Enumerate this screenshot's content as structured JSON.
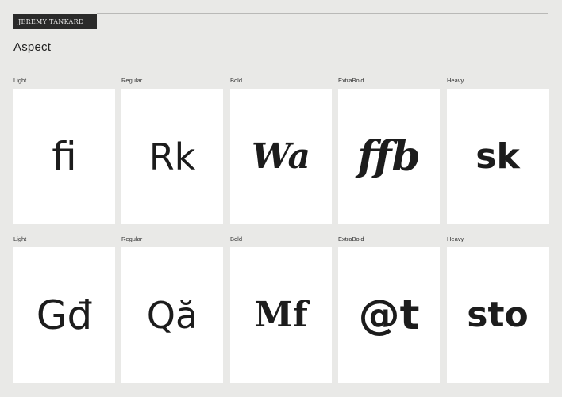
{
  "header": {
    "logo_text": "JEREMY TANKARD",
    "page_title": "Aspect"
  },
  "rows": [
    {
      "cells": [
        {
          "weight": "Light",
          "glyphs": "fi"
        },
        {
          "weight": "Regular",
          "glyphs": "Rk"
        },
        {
          "weight": "Bold",
          "glyphs": "Wa"
        },
        {
          "weight": "ExtraBold",
          "glyphs": "ffb"
        },
        {
          "weight": "Heavy",
          "glyphs": "sk"
        }
      ]
    },
    {
      "cells": [
        {
          "weight": "Light",
          "glyphs": "Gđ"
        },
        {
          "weight": "Regular",
          "glyphs": "Qă"
        },
        {
          "weight": "Bold",
          "glyphs": "Mf"
        },
        {
          "weight": "ExtraBold",
          "glyphs": "@t"
        },
        {
          "weight": "Heavy",
          "glyphs": "sto"
        }
      ]
    }
  ]
}
